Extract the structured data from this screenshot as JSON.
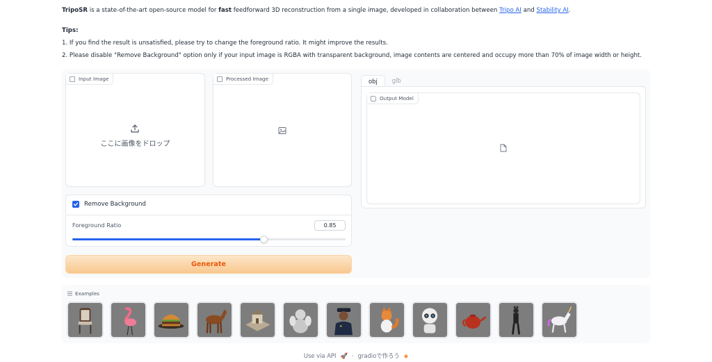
{
  "intro": {
    "brand": "TripoSR",
    "text_1": " is a state-of-the-art open-source model for ",
    "fast": "fast",
    "text_2": " feedforward 3D reconstruction from a single image, developed in collaboration between ",
    "link_1": "Tripo AI",
    "and": " and ",
    "link_2": "Stability AI",
    "period": ".",
    "tips_title": "Tips:",
    "tip_1": "1. If you find the result is unsatisfied, please try to change the foreground ratio. It might improve the results.",
    "tip_2": "2. Please disable \"Remove Background\" option only if your input image is RGBA with transparent background, image contents are centered and occupy more than 70% of image width or height."
  },
  "input_panel": {
    "label": "Input Image",
    "drop_text": "ここに画像をドロップ"
  },
  "processed_panel": {
    "label": "Processed Image"
  },
  "controls": {
    "remove_bg_label": "Remove Background",
    "remove_bg_checked": true,
    "ratio_label": "Foreground Ratio",
    "ratio_value": "0.85",
    "ratio_fraction": 0.7
  },
  "generate_label": "Generate",
  "output": {
    "tabs": [
      "obj",
      "glb"
    ],
    "active_tab": "obj",
    "label": "Output Model"
  },
  "examples": {
    "label": "Examples",
    "items": [
      "chair-icon",
      "flamingo-icon",
      "burger-icon",
      "horse-icon",
      "house-icon",
      "statue-icon",
      "police-icon",
      "fox-icon",
      "robot-icon",
      "teapot-icon",
      "catwoman-icon",
      "unicorn-icon"
    ]
  },
  "footer": {
    "api": "Use via API",
    "sep": "·",
    "built": "gradioで作ろう"
  },
  "colors": {
    "accent": "#2563eb",
    "generate_text": "#ea580c"
  }
}
